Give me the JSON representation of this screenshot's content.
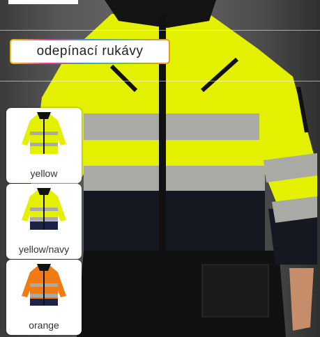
{
  "feature": {
    "label": "odepínací rukávy"
  },
  "colors": {
    "hivis_yellow": "#e3f000",
    "navy": "#1b2346",
    "orange": "#f27a12",
    "reflective": "#a9aaa6"
  },
  "variants": [
    {
      "caption": "yellow",
      "body": "#e3f000",
      "bottom": "#e3f000"
    },
    {
      "caption": "yellow/navy",
      "body": "#e3f000",
      "bottom": "#1b2346"
    },
    {
      "caption": "orange",
      "body": "#f27a12",
      "bottom": "#f27a12"
    }
  ]
}
